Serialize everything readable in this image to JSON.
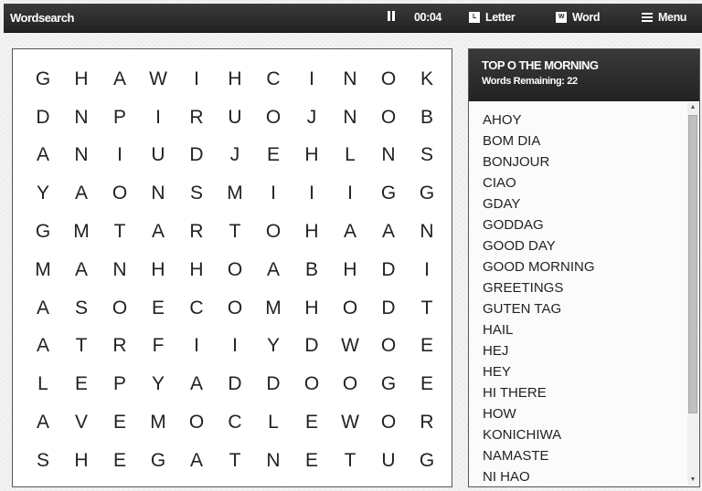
{
  "header": {
    "title": "Wordsearch",
    "timer": "00:04",
    "letter_label": "Letter",
    "letter_icon_glyph": "L",
    "word_label": "Word",
    "word_icon_glyph": "W",
    "menu_label": "Menu"
  },
  "grid": [
    [
      "G",
      "H",
      "A",
      "W",
      "I",
      "H",
      "C",
      "I",
      "N",
      "O",
      "K"
    ],
    [
      "D",
      "N",
      "P",
      "I",
      "R",
      "U",
      "O",
      "J",
      "N",
      "O",
      "B"
    ],
    [
      "A",
      "N",
      "I",
      "U",
      "D",
      "J",
      "E",
      "H",
      "L",
      "N",
      "S"
    ],
    [
      "Y",
      "A",
      "O",
      "N",
      "S",
      "M",
      "I",
      "I",
      "I",
      "G",
      "G"
    ],
    [
      "G",
      "M",
      "T",
      "A",
      "R",
      "T",
      "O",
      "H",
      "A",
      "A",
      "N"
    ],
    [
      "M",
      "A",
      "N",
      "H",
      "H",
      "O",
      "A",
      "B",
      "H",
      "D",
      "I"
    ],
    [
      "A",
      "S",
      "O",
      "E",
      "C",
      "O",
      "M",
      "H",
      "O",
      "D",
      "T"
    ],
    [
      "A",
      "T",
      "R",
      "F",
      "I",
      "I",
      "Y",
      "D",
      "W",
      "O",
      "E"
    ],
    [
      "L",
      "E",
      "P",
      "Y",
      "A",
      "D",
      "D",
      "O",
      "O",
      "G",
      "E"
    ],
    [
      "A",
      "V",
      "E",
      "M",
      "O",
      "C",
      "L",
      "E",
      "W",
      "O",
      "R"
    ],
    [
      "S",
      "H",
      "E",
      "G",
      "A",
      "T",
      "N",
      "E",
      "T",
      "U",
      "G"
    ]
  ],
  "words_panel": {
    "title": "TOP O THE MORNING",
    "remaining": "Words Remaining: 22",
    "words": [
      "AHOY",
      "BOM DIA",
      "BONJOUR",
      "CIAO",
      "GDAY",
      "GODDAG",
      "GOOD DAY",
      "GOOD MORNING",
      "GREETINGS",
      "GUTEN TAG",
      "HAIL",
      "HEJ",
      "HEY",
      "HI THERE",
      "HOW",
      "KONICHIWA",
      "NAMASTE",
      "NI HAO"
    ],
    "scroll_up_glyph": "▲",
    "scroll_down_glyph": "▼"
  }
}
